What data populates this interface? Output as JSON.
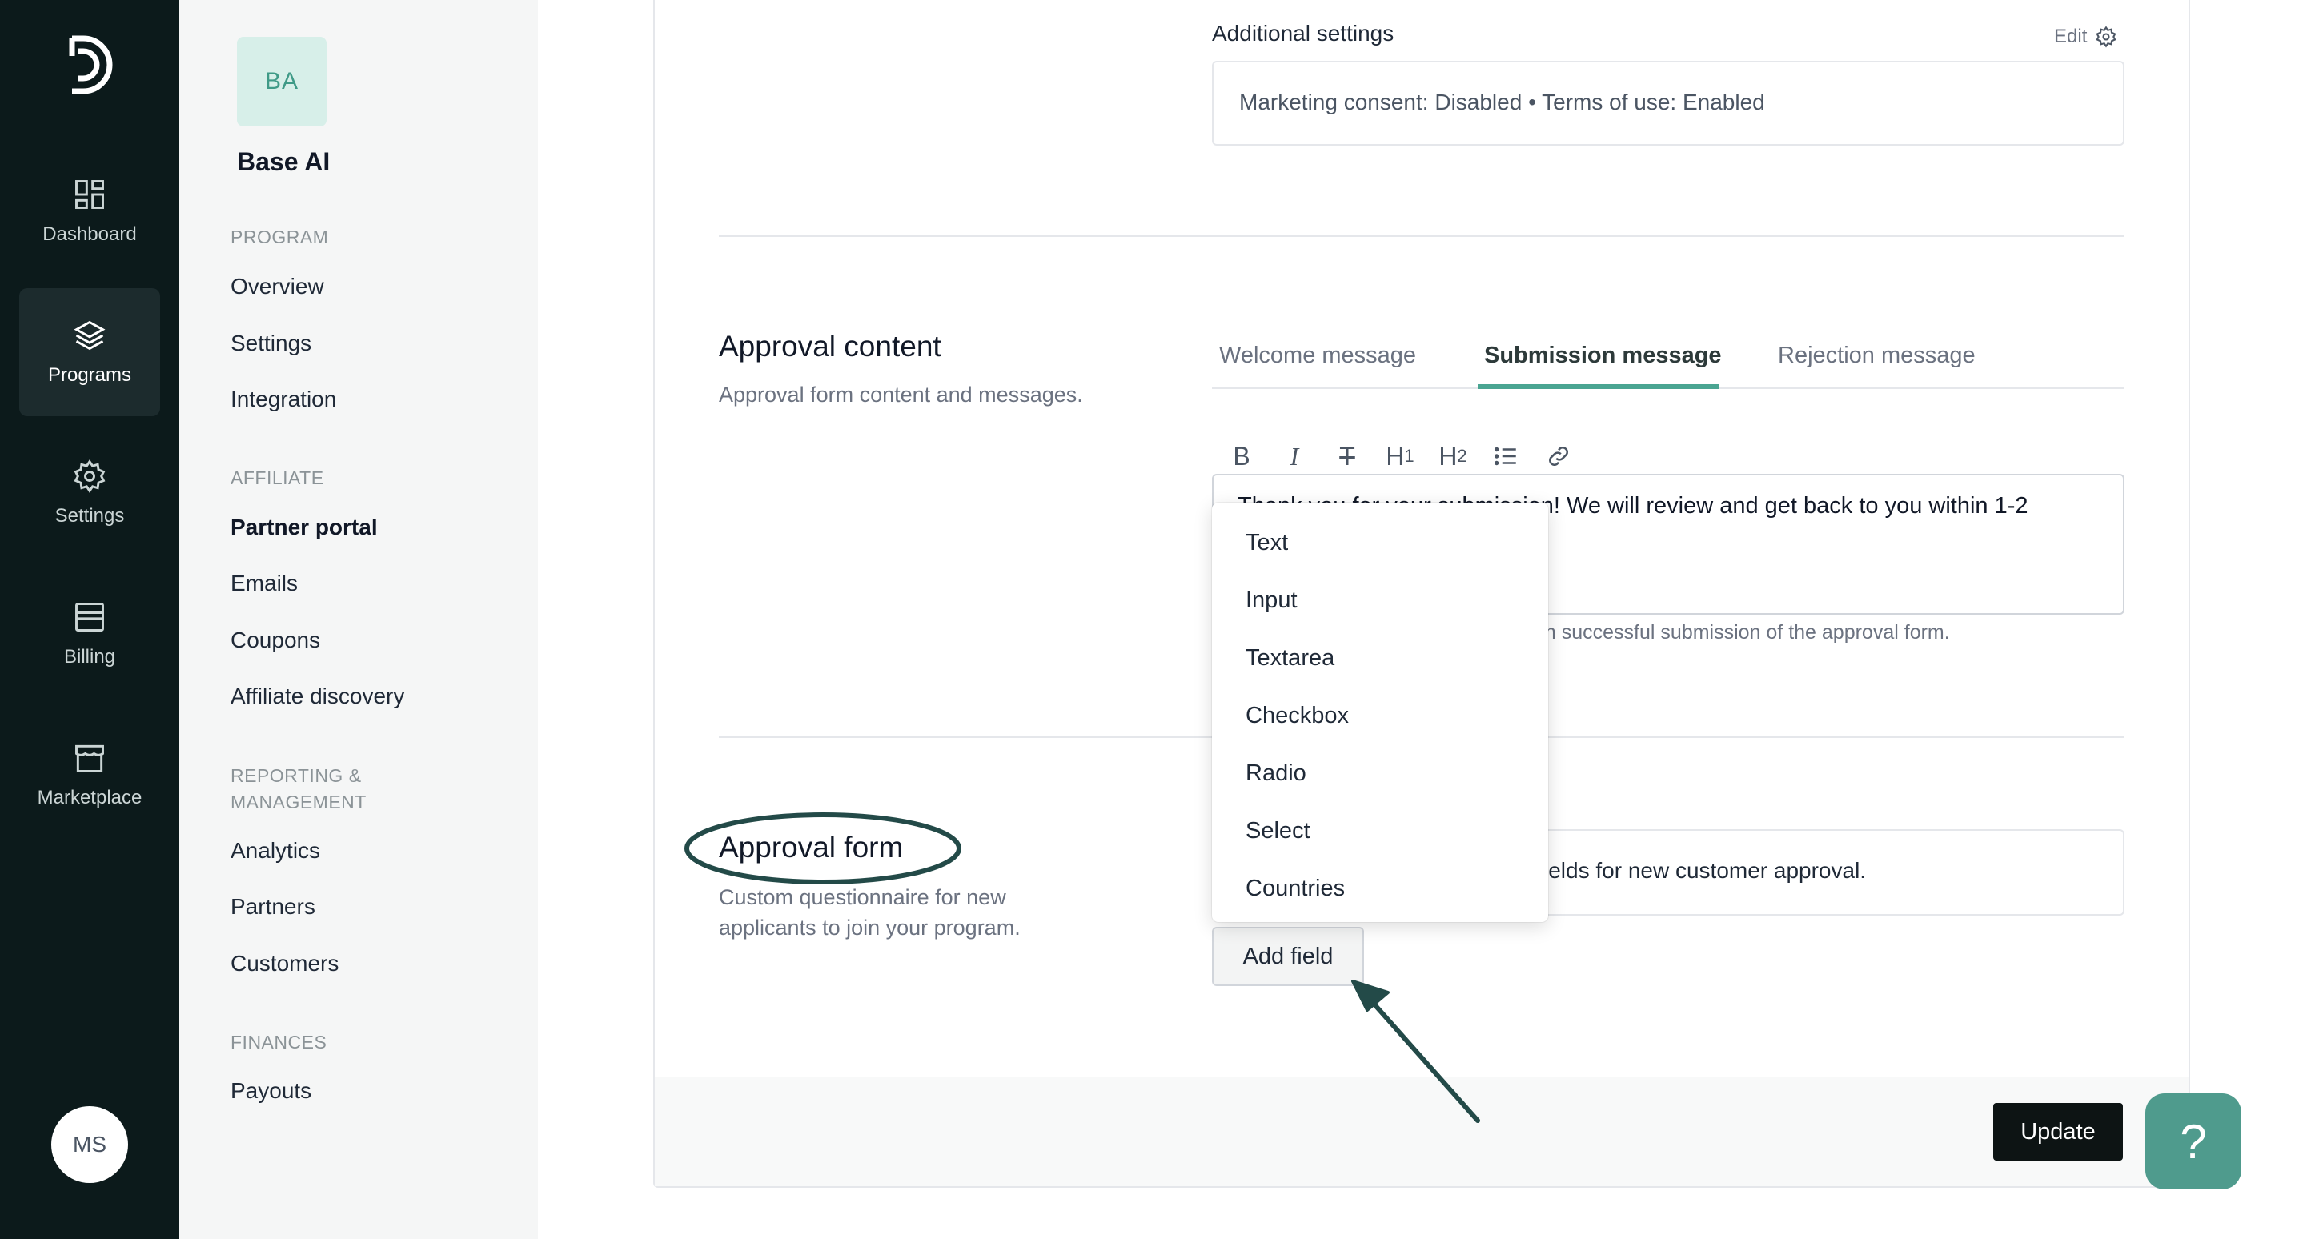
{
  "rail": {
    "items": [
      {
        "label": "Dashboard",
        "icon": "grid-icon"
      },
      {
        "label": "Programs",
        "icon": "layers-icon"
      },
      {
        "label": "Settings",
        "icon": "gear-icon"
      },
      {
        "label": "Billing",
        "icon": "card-icon"
      },
      {
        "label": "Marketplace",
        "icon": "store-icon"
      }
    ],
    "active": "Programs",
    "avatar": "MS"
  },
  "sidebar": {
    "badge": "BA",
    "brand": "Base AI",
    "sections": [
      {
        "title": "PROGRAM",
        "links": [
          "Overview",
          "Settings",
          "Integration"
        ]
      },
      {
        "title": "AFFILIATE",
        "links": [
          "Partner portal",
          "Emails",
          "Coupons",
          "Affiliate discovery"
        ]
      },
      {
        "title": "REPORTING & MANAGEMENT",
        "links": [
          "Analytics",
          "Partners",
          "Customers"
        ]
      },
      {
        "title": "FINANCES",
        "links": [
          "Payouts"
        ]
      }
    ],
    "active_link": "Partner portal"
  },
  "additional": {
    "label": "Additional settings",
    "edit": "Edit",
    "value": "Marketing consent: Disabled • Terms of use: Enabled"
  },
  "approval_content": {
    "title": "Approval content",
    "subtitle": "Approval form content and messages.",
    "tabs": [
      "Welcome message",
      "Submission message",
      "Rejection message"
    ],
    "active_tab": "Submission message",
    "editor_text": "Thank you for your submission! We will review and get back to you within 1-2",
    "helper": "on successful submission of the approval form."
  },
  "approval_form": {
    "title": "Approval form",
    "subtitle": "Custom questionnaire for new applicants to join your program.",
    "box_text": "ields for new customer approval.",
    "add_field": "Add field",
    "menu": [
      "Text",
      "Input",
      "Textarea",
      "Checkbox",
      "Radio",
      "Select",
      "Countries"
    ]
  },
  "footer": {
    "update": "Update",
    "help": "?"
  },
  "colors": {
    "rail_bg": "#0c1a1b",
    "accent": "#4aa592",
    "annotation": "#234a48"
  }
}
